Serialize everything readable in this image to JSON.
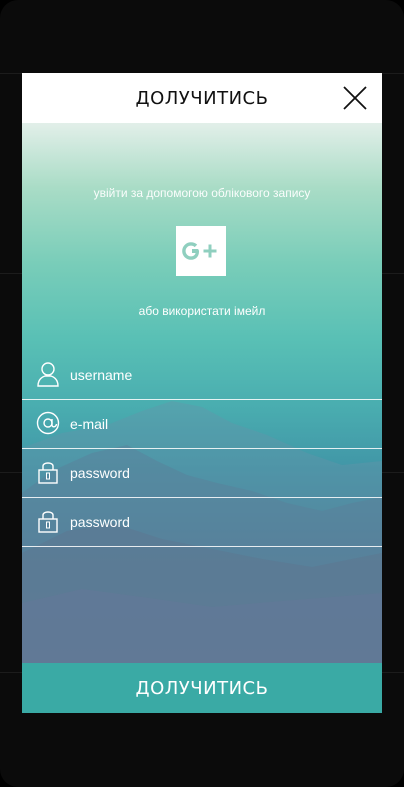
{
  "modal": {
    "title": "ДОЛУЧИТИСЬ",
    "close_icon": "close-icon"
  },
  "social": {
    "prompt": "увійти за допомогою облікового запису",
    "google_plus_label": "G+",
    "google_plus_icon": "google-plus-icon"
  },
  "email_prompt": "або використати імейл",
  "fields": {
    "username": {
      "placeholder": "username",
      "icon": "user-icon"
    },
    "email": {
      "placeholder": "e-mail",
      "icon": "at-sign-icon"
    },
    "password": {
      "placeholder": "password",
      "icon": "lock-icon"
    },
    "password_confirm": {
      "placeholder": "password",
      "icon": "lock-icon"
    }
  },
  "submit": {
    "label": "ДОЛУЧИТИСЬ"
  },
  "colors": {
    "accent": "#3aaaa5",
    "header_bg": "#ffffff",
    "text_on_accent": "#ffffff"
  }
}
